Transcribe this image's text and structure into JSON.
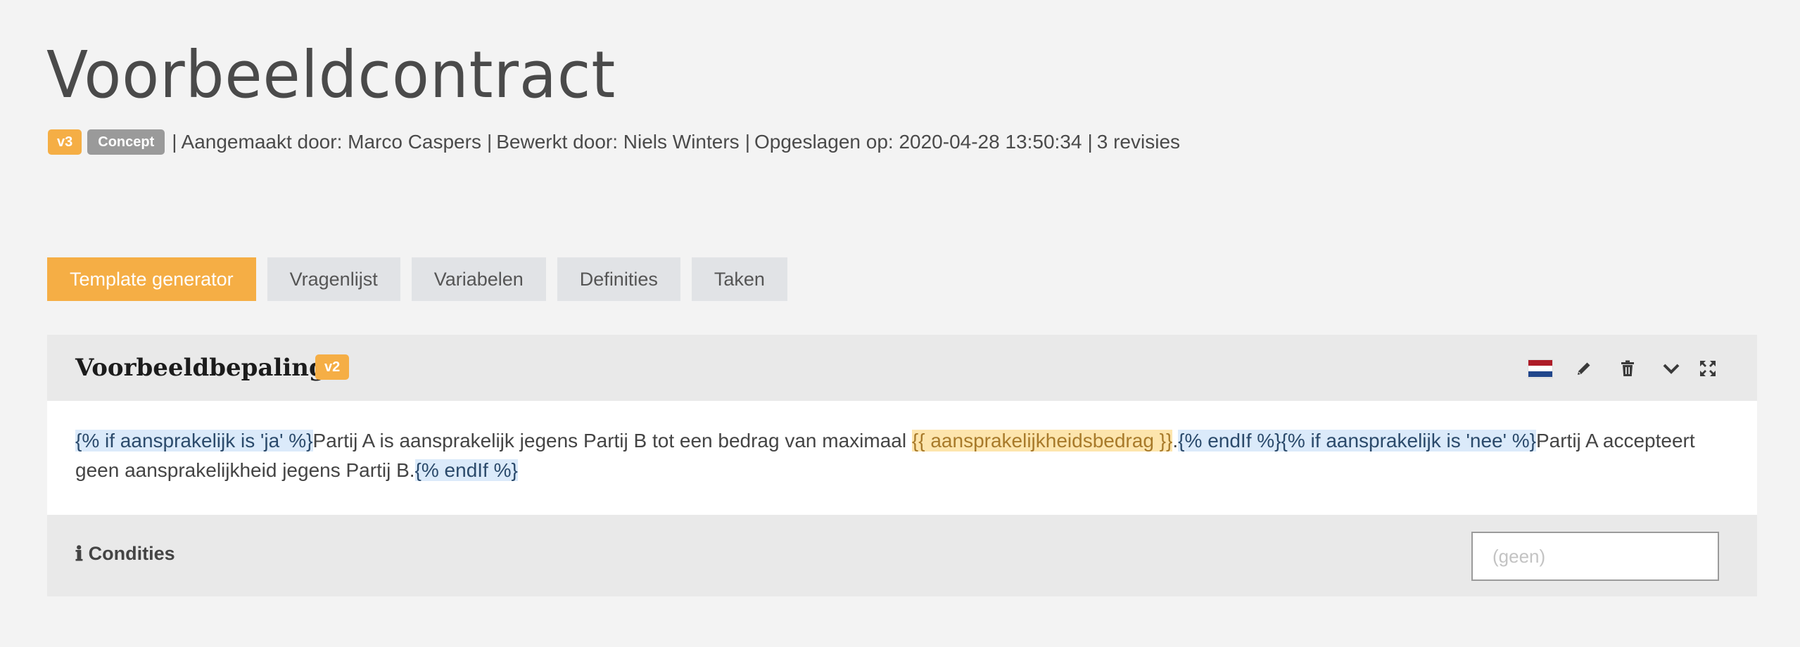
{
  "page": {
    "title": "Voorbeeldcontract",
    "version_badge": "v3",
    "status_badge": "Concept",
    "meta_created": "Aangemaakt door: Marco Caspers",
    "meta_edited": "Bewerkt door: Niels Winters",
    "meta_saved": "Opgeslagen op: 2020-04-28 13:50:34",
    "meta_revisions": "3 revisies",
    "separator": "|"
  },
  "tabs": [
    {
      "label": "Template generator",
      "active": true
    },
    {
      "label": "Vragenlijst",
      "active": false
    },
    {
      "label": "Variabelen",
      "active": false
    },
    {
      "label": "Definities",
      "active": false
    },
    {
      "label": "Taken",
      "active": false
    }
  ],
  "clause": {
    "title": "Voorbeeldbepaling",
    "version_badge": "v2",
    "actions": [
      "flag-nl-icon",
      "pencil-icon",
      "trash-icon",
      "chevron-down-icon",
      "expand-icon"
    ],
    "body": {
      "seg1": "{% if aansprakelijk is 'ja' %}",
      "seg2": "Partij A is aansprakelijk jegens Partij B tot een bedrag van maximaal ",
      "seg3": "{{ aansprakelijkheidsbedrag }}",
      "seg4": ".",
      "seg5": "{% endIf %}",
      "seg6": "{% if aansprakelijk is 'nee' %}",
      "seg7": "Partij A accepteert geen aansprakelijkheid jegens Partij B.",
      "seg8": "{% endIf %}"
    },
    "conditions_label": "Condities",
    "conditions_placeholder": "(geen)"
  },
  "colors": {
    "accent": "#f5ae45",
    "badge_grey": "#9a9a9a",
    "tab_bg": "#e1e3e6",
    "if_tag_bg": "#dbeafa",
    "var_tag_bg": "#fde5ad"
  }
}
